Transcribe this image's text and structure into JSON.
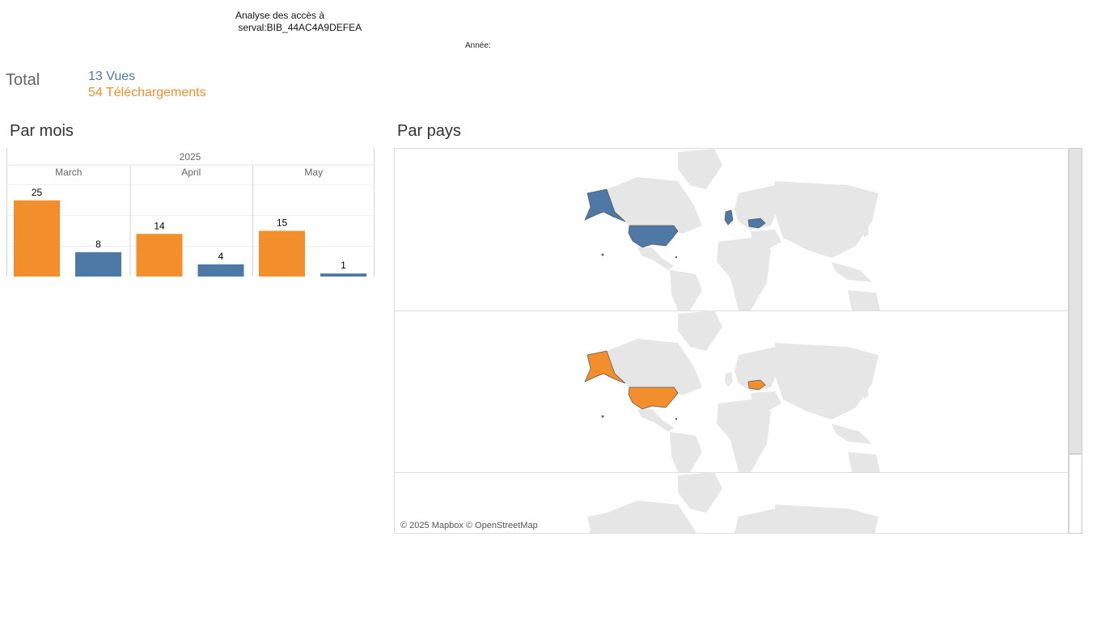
{
  "header": {
    "title": "Analyse des accès à\n serval:BIB_44AC4A9DEFEA",
    "year_label": "Année:"
  },
  "totals": {
    "label": "Total",
    "views": "13 Vues",
    "downloads": "54 Téléchargements"
  },
  "sections": {
    "by_month": "Par mois",
    "by_country": "Par pays"
  },
  "colors": {
    "views": "#4e79a7",
    "downloads": "#f28e2b"
  },
  "chart_data": {
    "type": "bar",
    "year": "2025",
    "categories": [
      "March",
      "April",
      "May"
    ],
    "series": [
      {
        "values": [
          25,
          14,
          15
        ],
        "color": "#f28e2b"
      },
      {
        "values": [
          8,
          4,
          1
        ],
        "color": "#4e79a7"
      }
    ],
    "grid": true
  },
  "map": {
    "attribution": "© 2025 Mapbox © OpenStreetMap",
    "rows": [
      {
        "highlight_color": "#4e79a7",
        "highlighted_countries": [
          "United States",
          "United Kingdom",
          "Ukraine"
        ]
      },
      {
        "highlight_color": "#f28e2b",
        "highlighted_countries": [
          "United States",
          "Ukraine"
        ]
      },
      {
        "highlight_color": "",
        "highlighted_countries": []
      }
    ]
  }
}
